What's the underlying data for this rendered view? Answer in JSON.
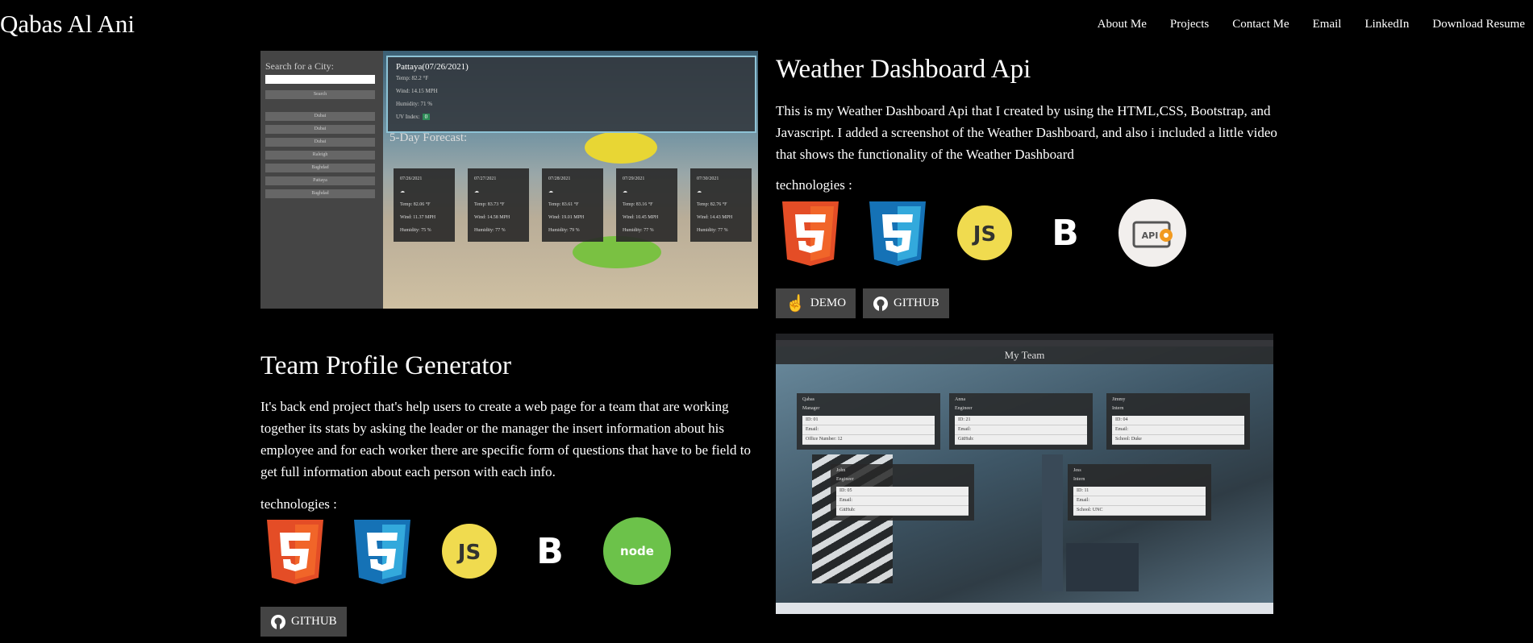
{
  "header": {
    "brand": "Qabas Al Ani",
    "nav": [
      "About Me",
      "Projects",
      "Contact Me",
      "Email",
      "LinkedIn",
      "Download Resume"
    ]
  },
  "weather": {
    "title": "Weather Dashboard Api",
    "description": "This is my Weather Dashboard Api that I created by using the HTML,CSS, Bootstrap, and Javascript. I added a screenshot of the Weather Dashboard, and also i included a little video that shows the functionality of the Weather Dashboard",
    "tech_label": "technologies :",
    "tech_icons": [
      "html5-icon",
      "css3-icon",
      "javascript-icon",
      "bootstrap-icon",
      "api-icon"
    ],
    "demo_label": "DEMO",
    "github_label": "GITHUB",
    "screenshot": {
      "search_label": "Search for a City:",
      "search_button": "Search",
      "history": [
        "Dubai",
        "Dubai",
        "Dubai",
        "Raleigh",
        "Baghdad",
        "Pattaya",
        "Baghdad"
      ],
      "city": "Pattaya(07/26/2021)",
      "temp": "Temp: 82.2 °F",
      "wind": "Wind: 14.15 MPH",
      "humidity": "Humidity: 71 %",
      "uv_label": "UV Index:",
      "uv_value": "0",
      "forecast_title": "5-Day Forecast:",
      "forecast": [
        {
          "date": "07/26/2021",
          "temp": "Temp: 82.06 °F",
          "wind": "Wind: 11.37 MPH",
          "humidity": "Humidity: 75 %"
        },
        {
          "date": "07/27/2021",
          "temp": "Temp: 83.73 °F",
          "wind": "Wind: 14.58 MPH",
          "humidity": "Humidity: 77 %"
        },
        {
          "date": "07/28/2021",
          "temp": "Temp: 83.61 °F",
          "wind": "Wind: 19.01 MPH",
          "humidity": "Humidity: 79 %"
        },
        {
          "date": "07/29/2021",
          "temp": "Temp: 83.16 °F",
          "wind": "Wind: 10.45 MPH",
          "humidity": "Humidity: 77 %"
        },
        {
          "date": "07/30/2021",
          "temp": "Temp: 82.76 °F",
          "wind": "Wind: 14.43 MPH",
          "humidity": "Humidity: 77 %"
        }
      ]
    }
  },
  "team": {
    "title": "Team Profile Generator",
    "description": "It's back end project that's help users to create a web page for a team that are working together its stats by asking the leader or the manager the insert information about his employee and for each worker there are specific form of questions that have to be field to get full information about each person with each info.",
    "tech_label": "technologies :",
    "tech_icons": [
      "html5-icon",
      "css3-icon",
      "javascript-icon",
      "bootstrap-icon",
      "nodejs-icon"
    ],
    "github_label": "GITHUB",
    "screenshot": {
      "heading": "My Team",
      "members": [
        {
          "name": "Qabas",
          "role": "Manager",
          "id": "ID: 01",
          "email": "Email:",
          "extra": "Office Number: 12"
        },
        {
          "name": "Anna",
          "role": "Engineer",
          "id": "ID: 21",
          "email": "Email:",
          "extra": "GitHub:"
        },
        {
          "name": "Jimmy",
          "role": "Intern",
          "id": "ID: 04",
          "email": "Email:",
          "extra": "School: Duke"
        },
        {
          "name": "John",
          "role": "Engineer",
          "id": "ID: 05",
          "email": "Email:",
          "extra": "GitHub:"
        },
        {
          "name": "Jess",
          "role": "Intern",
          "id": "ID: 11",
          "email": "Email:",
          "extra": "School: UNC"
        }
      ]
    }
  }
}
